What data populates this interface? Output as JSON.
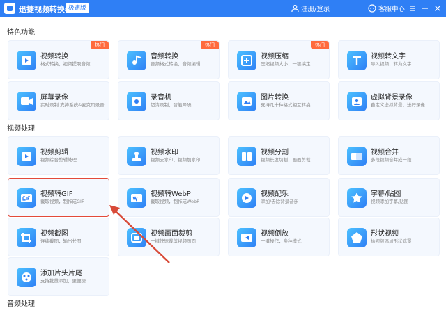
{
  "header": {
    "app_title": "迅捷视频转换器",
    "badge": "极速版",
    "login": "注册/登录",
    "customer_service": "客服中心"
  },
  "sections": {
    "features": "特色功能",
    "video": "视频处理",
    "audio": "音频处理"
  },
  "features": [
    {
      "title": "视频转换",
      "desc": "格式转换，视频提取音频",
      "tag": "热门"
    },
    {
      "title": "音频转换",
      "desc": "音频格式转换，音频编辑",
      "tag": "热门"
    },
    {
      "title": "视频压缩",
      "desc": "压缩视频大小，一键搞定",
      "tag": "热门"
    },
    {
      "title": "视频转文字",
      "desc": "导入视频，转为文字",
      "tag": ""
    },
    {
      "title": "屏幕录像",
      "desc": "实时录制 支持系统&麦克风录音",
      "tag": ""
    },
    {
      "title": "录音机",
      "desc": "超清录制，智能降噪",
      "tag": ""
    },
    {
      "title": "图片转换",
      "desc": "支持几十种格式相互转换",
      "tag": ""
    },
    {
      "title": "虚拟背景录像",
      "desc": "自定义虚拟背景，进行录像",
      "tag": ""
    }
  ],
  "video_tools": [
    {
      "title": "视频剪辑",
      "desc": "视频综合剪辑处理"
    },
    {
      "title": "视频水印",
      "desc": "视频去水印，视频加水印"
    },
    {
      "title": "视频分割",
      "desc": "视频长度切割，画面剪裁"
    },
    {
      "title": "视频合并",
      "desc": "多段视频合并成一段"
    },
    {
      "title": "视频转GIF",
      "desc": "截取视频，制作成GIF"
    },
    {
      "title": "视频转WebP",
      "desc": "截取视频，制作成WebP"
    },
    {
      "title": "视频配乐",
      "desc": "添加/去除背景音乐"
    },
    {
      "title": "字幕/贴图",
      "desc": "视频添加字幕/贴图"
    },
    {
      "title": "视频截图",
      "desc": "连续截图，输出长图"
    },
    {
      "title": "视频画面裁剪",
      "desc": "一键快速裁剪视频画面"
    },
    {
      "title": "视频倒放",
      "desc": "一键操作，多种模式"
    },
    {
      "title": "形状视频",
      "desc": "给视频添加形状遮罩"
    },
    {
      "title": "添加片头片尾",
      "desc": "支持批量添加，更便捷"
    }
  ],
  "colors": {
    "titlebar": "#2f7ff5",
    "hot_tag": "#ff6a3d",
    "highlight_border": "#e34a3a",
    "card_bg": "#f4f8fe"
  },
  "highlighted_tool": "视频转GIF"
}
